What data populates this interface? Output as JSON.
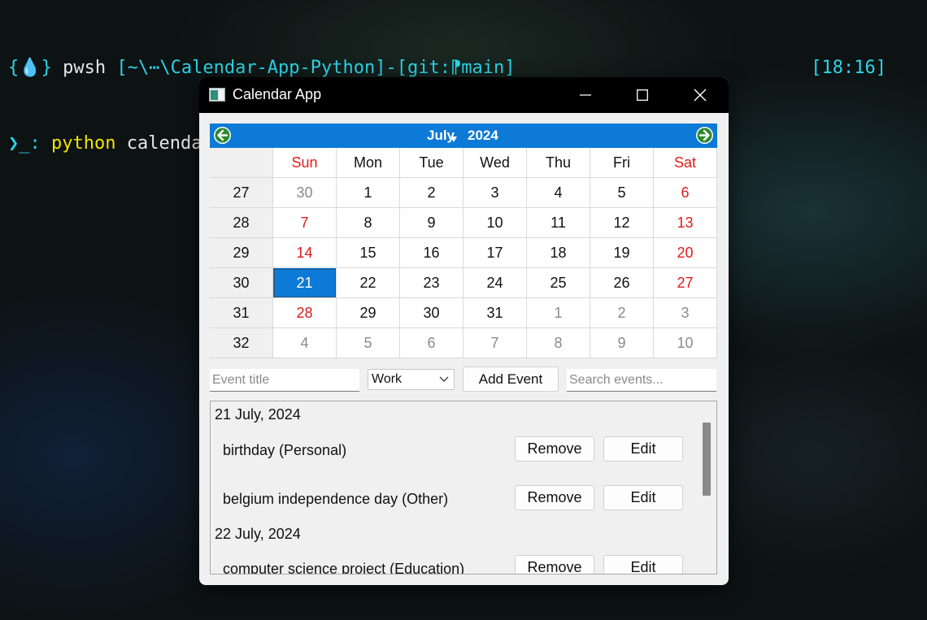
{
  "terminal": {
    "prompt_icon": "{💧}",
    "shell": "pwsh",
    "path": "[~\\⋯\\Calendar-App-Python]",
    "dash": "-",
    "git": "[git:",
    "branch_icon": "⁋",
    "branch": "main]",
    "clock": "[18:16]",
    "prompt2": "❯_:",
    "cmd": "python",
    "arg": "calendar_app.py"
  },
  "window": {
    "title": "Calendar App"
  },
  "calendar": {
    "month": "July",
    "year": "2024",
    "headers": [
      "",
      "Sun",
      "Mon",
      "Tue",
      "Wed",
      "Thu",
      "Fri",
      "Sat"
    ],
    "weeks": [
      {
        "num": "27",
        "days": [
          "30",
          "1",
          "2",
          "3",
          "4",
          "5",
          "6"
        ]
      },
      {
        "num": "28",
        "days": [
          "7",
          "8",
          "9",
          "10",
          "11",
          "12",
          "13"
        ]
      },
      {
        "num": "29",
        "days": [
          "14",
          "15",
          "16",
          "17",
          "18",
          "19",
          "20"
        ]
      },
      {
        "num": "30",
        "days": [
          "21",
          "22",
          "23",
          "24",
          "25",
          "26",
          "27"
        ]
      },
      {
        "num": "31",
        "days": [
          "28",
          "29",
          "30",
          "31",
          "1",
          "2",
          "3"
        ]
      },
      {
        "num": "32",
        "days": [
          "4",
          "5",
          "6",
          "7",
          "8",
          "9",
          "10"
        ]
      }
    ],
    "selected": "21",
    "accent": "#0c7ad6",
    "weekend_color": "#e01b1b"
  },
  "controls": {
    "title_placeholder": "Event title",
    "category_value": "Work",
    "add_label": "Add Event",
    "search_placeholder": "Search events..."
  },
  "events": {
    "groups": [
      {
        "date": "21 July, 2024",
        "items": [
          "birthday (Personal)",
          "belgium independence day (Other)"
        ]
      },
      {
        "date": "22 July, 2024",
        "items": [
          "computer science project (Education)"
        ]
      }
    ],
    "remove_label": "Remove",
    "edit_label": "Edit"
  }
}
